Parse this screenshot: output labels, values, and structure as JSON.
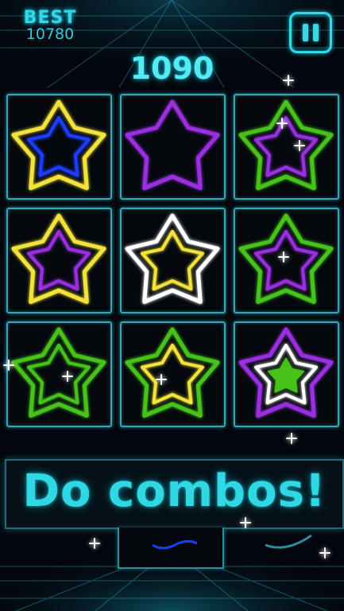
{
  "hud": {
    "best_label": "BEST",
    "best_value": "10780",
    "score": "1090"
  },
  "pause_icon": "pause-icon",
  "board": {
    "rows": 3,
    "cols": 3,
    "cells": [
      {
        "outer": "#f2e23a",
        "inner": "#1c3dff",
        "fill": null
      },
      {
        "outer": "#9a2fe0",
        "inner": null,
        "fill": null
      },
      {
        "outer": "#46c21a",
        "inner": "#9a2fe0",
        "fill": null
      },
      {
        "outer": "#f2e23a",
        "inner": "#9a2fe0",
        "fill": null
      },
      {
        "outer": "#ffffff",
        "inner": "#f2e23a",
        "fill": null
      },
      {
        "outer": "#46c21a",
        "inner": "#9a2fe0",
        "fill": null
      },
      {
        "outer": "#46c21a",
        "inner": "#46c21a",
        "fill": null
      },
      {
        "outer": "#46c21a",
        "inner": "#f2e23a",
        "fill": null
      },
      {
        "outer": "#9a2fe0",
        "inner": "#ffffff",
        "fill": "#46c21a"
      }
    ]
  },
  "banner": {
    "text": "Do combos!"
  },
  "colors": {
    "accent": "#35d8e6",
    "grid": "#2fa9b8",
    "background": "#03070d"
  }
}
